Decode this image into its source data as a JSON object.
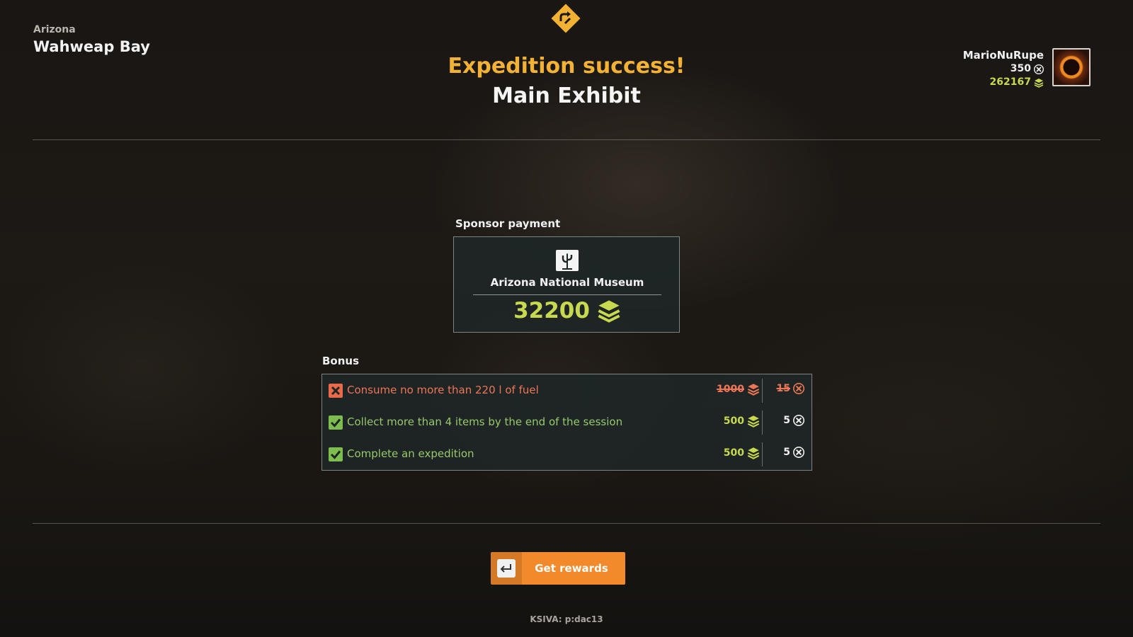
{
  "location": {
    "region": "Arizona",
    "place": "Wahweap Bay"
  },
  "header": {
    "title": "Expedition success!",
    "subtitle": "Main Exhibit",
    "icon": "expedition-sign-icon"
  },
  "player": {
    "name": "MarioNuRupe",
    "xp": "350",
    "money": "262167"
  },
  "sponsor": {
    "label": "Sponsor payment",
    "name": "Arizona National Museum",
    "amount": "32200"
  },
  "bonus": {
    "label": "Bonus",
    "items": [
      {
        "status": "failed",
        "text": "Consume no more than 220 l of fuel",
        "money": "1000",
        "xp": "15"
      },
      {
        "status": "completed",
        "text": "Collect more than 4 items by the end of the session",
        "money": "500",
        "xp": "5"
      },
      {
        "status": "completed",
        "text": "Complete an expedition",
        "money": "500",
        "xp": "5"
      }
    ]
  },
  "actions": {
    "get_rewards": "Get rewards"
  },
  "build_info": "KSIVA: p:dac13",
  "colors": {
    "accent": "#f28a2c",
    "gold": "#f3b233",
    "money": "#c7d94f",
    "fail": "#ee7656",
    "success": "#7dbc4e"
  }
}
